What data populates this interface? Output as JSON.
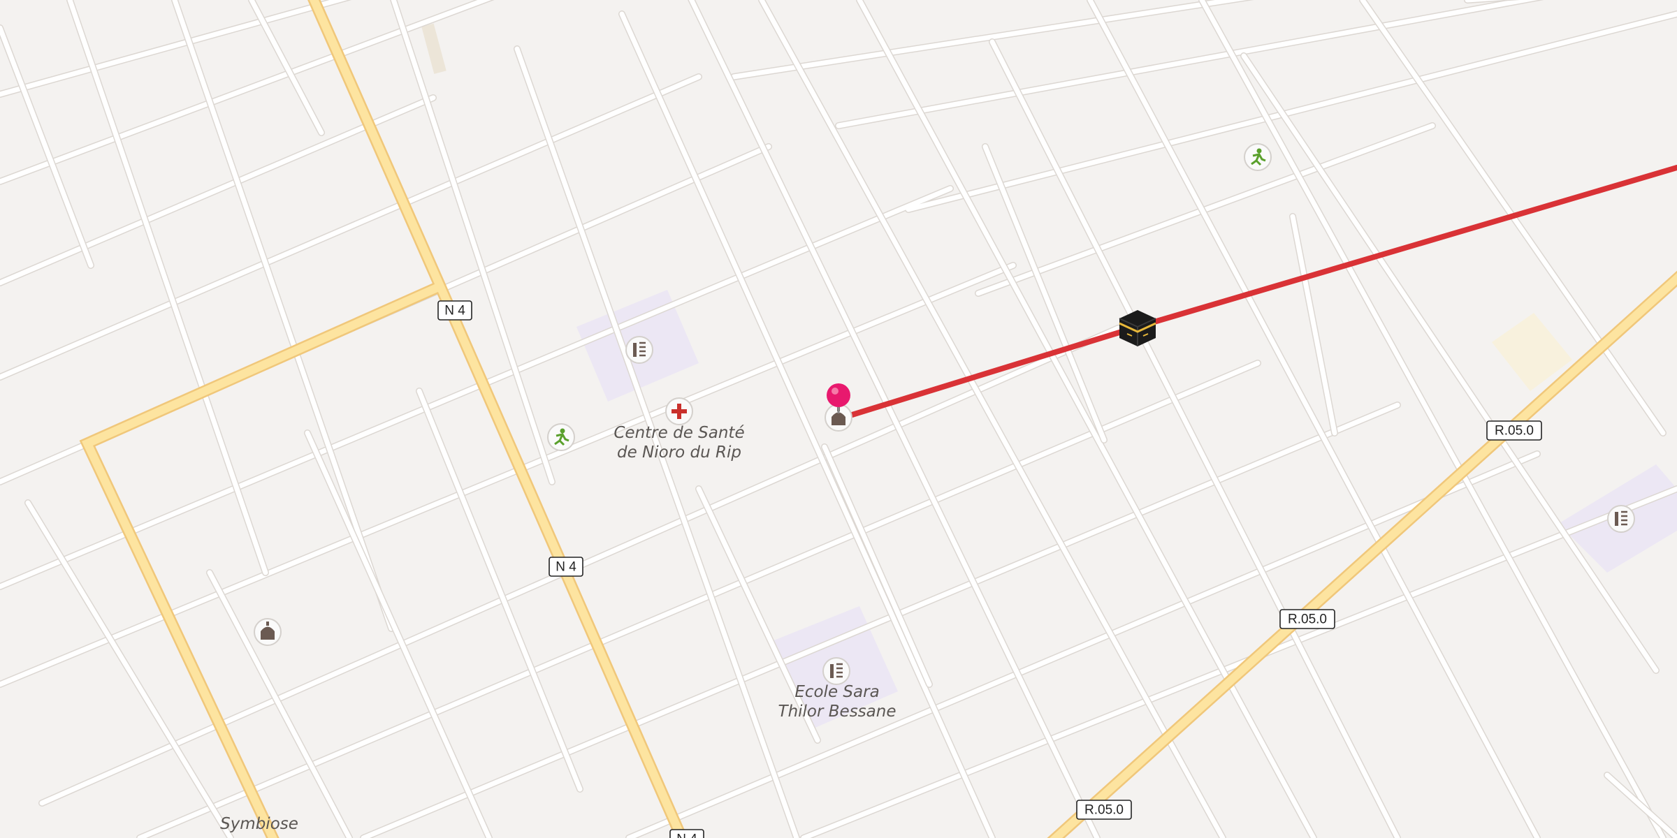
{
  "map": {
    "colors": {
      "background": "#f4f2f0",
      "street": "#ffffff",
      "primary_road": "#fde4a0",
      "route": "#d93236",
      "school_area": "#ece7f4",
      "pin": "#e8196e"
    },
    "road_shields": [
      "N 4",
      "N 4",
      "N 4",
      "R.05.0",
      "R.05.0",
      "R.05.0"
    ],
    "places": {
      "health_center": {
        "name_line1": "Centre de Santé",
        "name_line2": "de Nioro du Rip",
        "icon": "health-cross-icon"
      },
      "school": {
        "name_line1": "Ecole Sara",
        "name_line2": "Thilor Bessane",
        "icon": "school-icon"
      },
      "symbiose": {
        "name": "Symbiose"
      }
    },
    "poi_icons": [
      "school-icon",
      "sports-pitch-icon",
      "mosque-icon",
      "kaaba-icon",
      "location-pin-icon"
    ],
    "route": {
      "description_icon": "kaaba-icon"
    }
  }
}
